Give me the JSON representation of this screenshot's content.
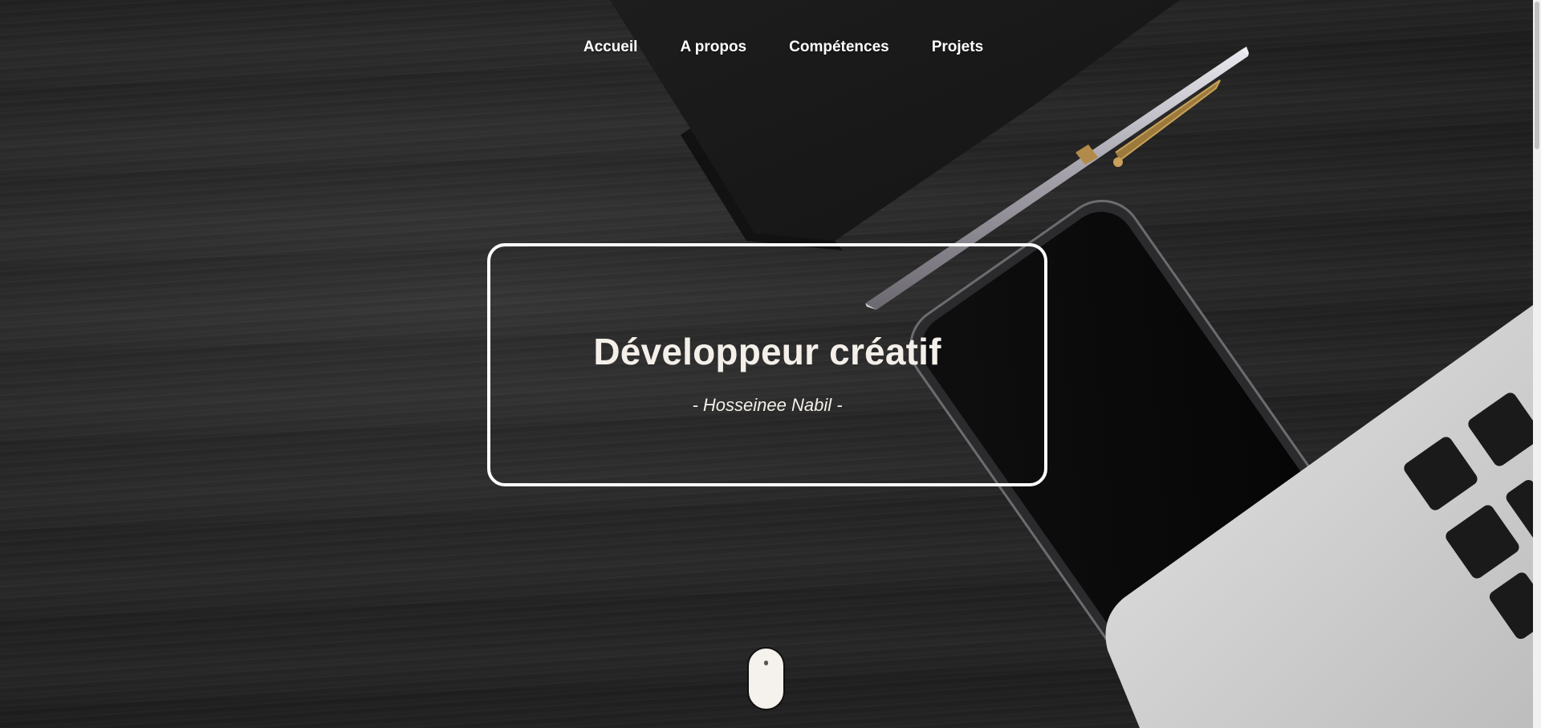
{
  "nav": {
    "items": [
      {
        "label": "Accueil"
      },
      {
        "label": "A propos"
      },
      {
        "label": "Compétences"
      },
      {
        "label": "Projets"
      }
    ]
  },
  "hero": {
    "title": "Développeur créatif",
    "subtitle": "- Hosseinee Nabil -"
  },
  "colors": {
    "text": "#ffffff",
    "title_text": "#f4efe9",
    "background": "#262626",
    "mouse_fill": "#f5f1ec"
  },
  "icons": {
    "scroll": "mouse-scroll-icon"
  }
}
